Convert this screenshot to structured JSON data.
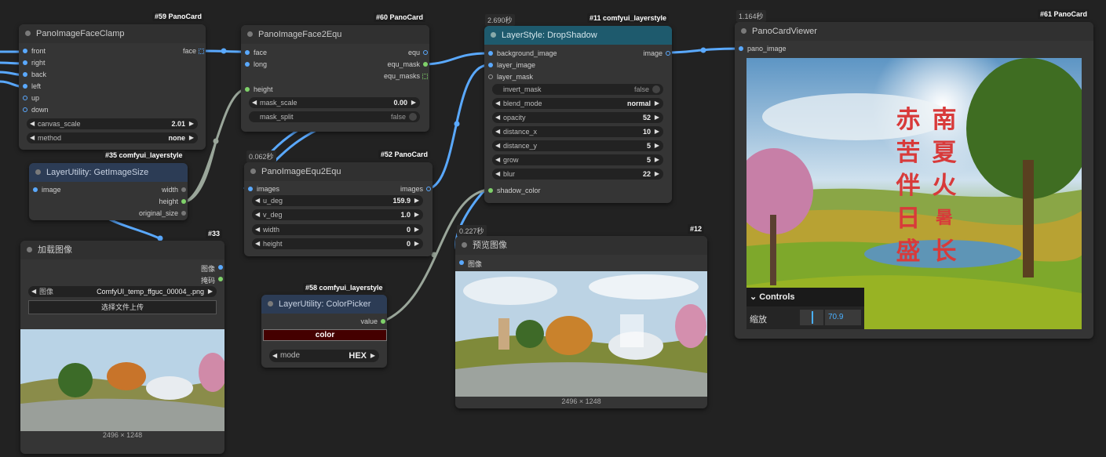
{
  "nodes": {
    "n59": {
      "tag": "#59 PanoCard",
      "title": "PanoImageFaceClamp",
      "inputs": [
        "front",
        "right",
        "back",
        "left",
        "up",
        "down"
      ],
      "output": "face",
      "canvas_scale": {
        "label": "canvas_scale",
        "value": "2.01"
      },
      "method": {
        "label": "method",
        "value": "none"
      }
    },
    "n60": {
      "tag": "#60 PanoCard",
      "title": "PanoImageFace2Equ",
      "inputs": [
        "face",
        "long"
      ],
      "outputs": [
        "equ",
        "equ_mask",
        "equ_masks"
      ],
      "height_input": "height",
      "mask_scale": {
        "label": "mask_scale",
        "value": "0.00"
      },
      "mask_split": {
        "label": "mask_split",
        "value": "false"
      }
    },
    "n11": {
      "time": "2.690秒",
      "tag": "#11 comfyui_layerstyle",
      "title": "LayerStyle: DropShadow",
      "inputs": [
        "background_image",
        "layer_image",
        "layer_mask"
      ],
      "output": "image",
      "widgets": [
        {
          "label": "invert_mask",
          "value": "false",
          "toggle": true
        },
        {
          "label": "blend_mode",
          "value": "normal"
        },
        {
          "label": "opacity",
          "value": "52"
        },
        {
          "label": "distance_x",
          "value": "10"
        },
        {
          "label": "distance_y",
          "value": "5"
        },
        {
          "label": "grow",
          "value": "5"
        },
        {
          "label": "blur",
          "value": "22"
        }
      ],
      "shadow_input": "shadow_color"
    },
    "n61": {
      "time": "1.164秒",
      "tag": "#61 PanoCard",
      "title": "PanoCardViewer",
      "input": "pano_image",
      "poem": [
        "赤",
        "南",
        "苦",
        "夏",
        "伴",
        "火",
        "日",
        "暑",
        "盛",
        "长"
      ],
      "controls_label": "Controls",
      "zoom_label": "缩放",
      "zoom_value": "70.9",
      "zoom_fraction": 0.709
    },
    "n35": {
      "tag": "#35 comfyui_layerstyle",
      "title": "LayerUtility: GetImageSize",
      "input": "image",
      "outputs": [
        "width",
        "height",
        "original_size"
      ]
    },
    "n52": {
      "time": "0.062秒",
      "tag": "#52 PanoCard",
      "title": "PanoImageEqu2Equ",
      "input": "images",
      "output": "images",
      "widgets": [
        {
          "label": "u_deg",
          "value": "159.9"
        },
        {
          "label": "v_deg",
          "value": "1.0"
        },
        {
          "label": "width",
          "value": "0"
        },
        {
          "label": "height",
          "value": "0"
        }
      ]
    },
    "n33": {
      "tag": "#33",
      "title": "加载图像",
      "outputs": [
        "图像",
        "掩码"
      ],
      "image_widget": {
        "label": "图像",
        "value": "ComfyUI_temp_ffguc_00004_.png"
      },
      "upload_label": "选择文件上传",
      "dims": "2496 × 1248"
    },
    "n58": {
      "tag": "#58 comfyui_layerstyle",
      "title": "LayerUtility: ColorPicker",
      "output": "value",
      "color_label": "color",
      "color_value": "#440000",
      "mode": {
        "label": "mode",
        "value": "HEX"
      }
    },
    "n12": {
      "time": "0.227秒",
      "tag": "#12",
      "title": "预览图像",
      "input": "图像",
      "dims": "2496 × 1248"
    }
  },
  "colors": {
    "wire": "#5aa9ff",
    "wire_grey": "#9aa69a",
    "canvas": "#222222",
    "node": "#353535"
  }
}
